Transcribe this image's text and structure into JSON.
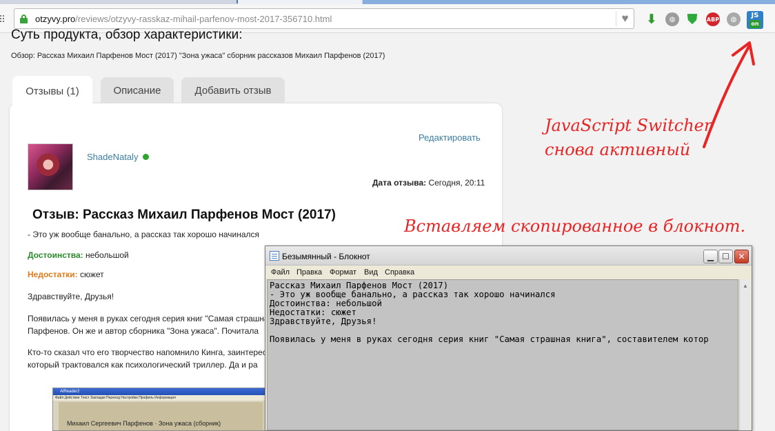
{
  "browser": {
    "url_host": "otzyvy.pro",
    "url_path": "/reviews/otzyvy-rasskaz-mihail-parfenov-most-2017-356710.html",
    "extensions": [
      "download-icon",
      "globe-icon",
      "shield-check-icon",
      "adblock-plus-icon",
      "globe-icon",
      "javascript-switcher-icon"
    ],
    "js_switcher": {
      "label": "JS",
      "state": "on"
    },
    "abp_label": "ABP"
  },
  "page": {
    "heading": "Суть продукта, обзор характеристики:",
    "breadcrumb": "Обзор: Рассказ Михаил Парфенов Мост (2017) \"Зона ужаса\" сборник рассказов Михаил Парфенов (2017)",
    "tabs": [
      {
        "label": "Отзывы (1)",
        "active": true
      },
      {
        "label": "Описание",
        "active": false
      },
      {
        "label": "Добавить отзыв",
        "active": false
      }
    ]
  },
  "review": {
    "edit_label": "Редактировать",
    "author": "ShadeNataly",
    "date_label": "Дата отзыва:",
    "date_value": "Сегодня, 20:11",
    "title": "Отзыв: Рассказ Михаил Парфенов Мост (2017)",
    "summary": "- Это уж вообще банально, а рассказ так хорошо начинался",
    "pros_label": "Достоинства:",
    "pros_value": "небольшой",
    "cons_label": "Недостатки:",
    "cons_value": "сюжет",
    "greeting": "Здравствуйте, Друзья!",
    "para1_line1": "Появилась у меня в руках сегодня серия книг \"Самая страшная книга\", составителем которой",
    "para1_line2": "Парфенов. Он же и автор сборника \"Зона ужаса\". Почитала",
    "para2_line1": "Кто-то сказал что его творчество напомнило Кинга, заинтересовало",
    "para2_line2": "который трактовался как психологический триллер. Да и ра",
    "embedded": {
      "window_title": "AlReader2",
      "menu": "Файл  Действие  Текст  Закладки  Переход  Настройки  Профиль  Информация",
      "caption": "Михаил Сергеевич Парфенов · Зона ужаса (сборник)"
    }
  },
  "annotations": {
    "js_line1": "JavaScript Switcher",
    "js_line2": "снова активный",
    "paste": "Вставляем скопированное в блокнот.",
    "color": "#e82424"
  },
  "notepad": {
    "title": "Безымянный - Блокнот",
    "menu": [
      "Файл",
      "Правка",
      "Формат",
      "Вид",
      "Справка"
    ],
    "text": "Рассказ Михаил Парфенов Мост (2017)\n- Это уж вообще банально, а рассказ так хорошо начинался\nДостоинства: небольшой\nНедостатки: сюжет\nЗдравствуйте, Друзья!\n\nПоявилась у меня в руках сегодня серия книг \"Самая страшная книга\", составителем котор"
  }
}
